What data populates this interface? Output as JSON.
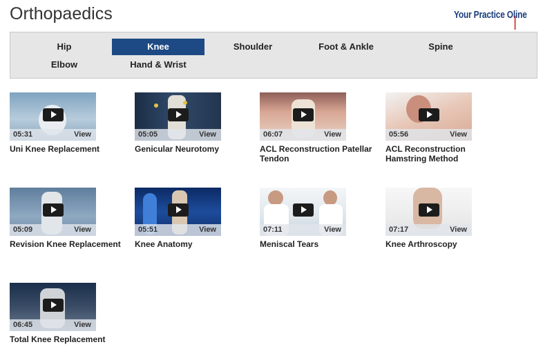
{
  "page": {
    "title": "Orthopaedics"
  },
  "logo": {
    "text_a": "Your Practice O",
    "text_b": "line"
  },
  "tabs": [
    {
      "label": "Hip"
    },
    {
      "label": "Knee",
      "active": true
    },
    {
      "label": "Shoulder"
    },
    {
      "label": "Foot & Ankle"
    },
    {
      "label": "Spine"
    },
    {
      "label": "Elbow"
    },
    {
      "label": "Hand & Wrist"
    }
  ],
  "videos": [
    {
      "title": "Uni Knee Replacement",
      "duration": "05:31",
      "view": "View"
    },
    {
      "title": "Genicular Neurotomy",
      "duration": "05:05",
      "view": "View"
    },
    {
      "title": "ACL Reconstruction Patellar Tendon",
      "duration": "06:07",
      "view": "View"
    },
    {
      "title": "ACL Reconstruction Hamstring Method",
      "duration": "05:56",
      "view": "View"
    },
    {
      "title": "Revision Knee Replacement",
      "duration": "05:09",
      "view": "View"
    },
    {
      "title": "Knee Anatomy",
      "duration": "05:51",
      "view": "View"
    },
    {
      "title": "Meniscal Tears",
      "duration": "07:11",
      "view": "View"
    },
    {
      "title": "Knee Arthroscopy",
      "duration": "07:17",
      "view": "View"
    },
    {
      "title": "Total Knee Replacement",
      "duration": "06:45",
      "view": "View"
    }
  ],
  "colors": {
    "active_tab": "#1d4a84",
    "logo_blue": "#1a3d7c",
    "logo_red": "#c62828"
  }
}
